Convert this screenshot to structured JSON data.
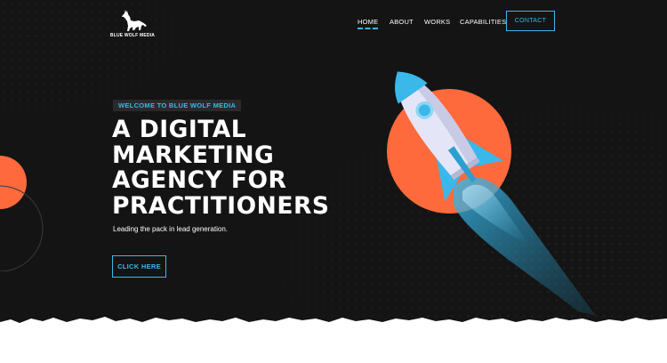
{
  "brand": {
    "logo_text": "BLUE WOLF MEDIA"
  },
  "nav": {
    "items": [
      "HOME",
      "ABOUT",
      "WORKS",
      "CAPABILITIES"
    ],
    "active": "HOME",
    "contact_label": "CONTACT"
  },
  "hero": {
    "badge": "WELCOME TO BLUE WOLF MEDIA",
    "headline": [
      "A DIGITAL",
      "MARKETING",
      "AGENCY FOR",
      "PRACTITIONERS"
    ],
    "subtext": "Leading the pack in lead generation.",
    "cta_label": "CLICK HERE"
  },
  "icons": {
    "logo": "wolf-howling-icon",
    "hero_art": "rocket-illustration"
  },
  "colors": {
    "background": "#141414",
    "accent": "#3ab8ea",
    "orange": "#ff6a3d",
    "white": "#ffffff"
  }
}
